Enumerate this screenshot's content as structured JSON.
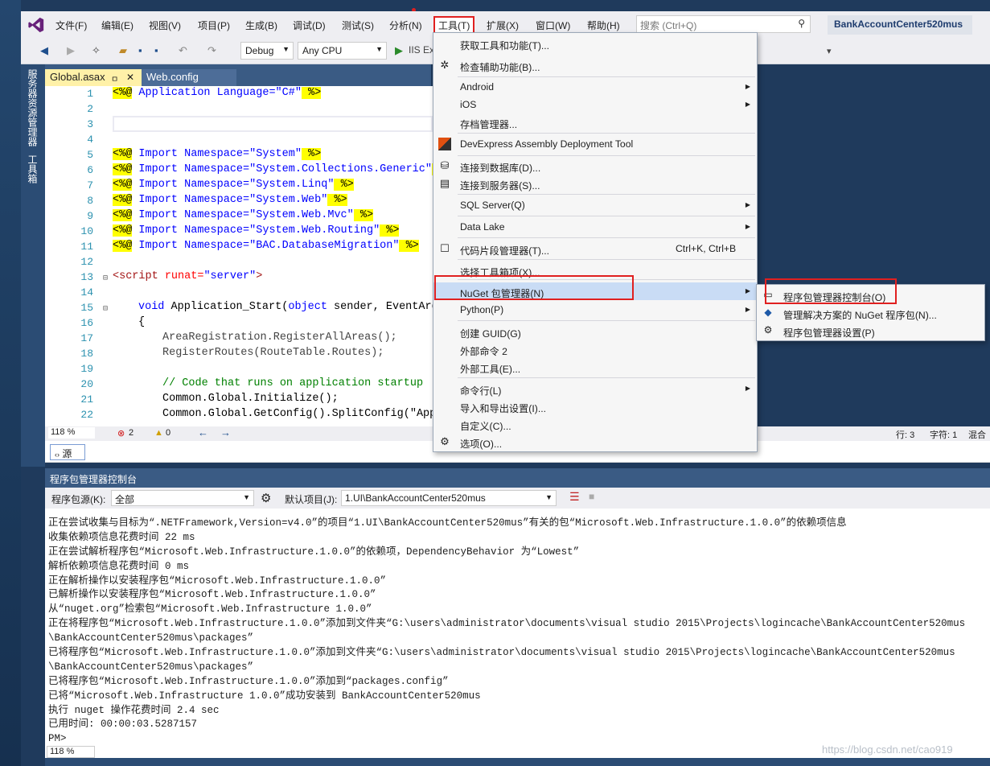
{
  "window": {
    "solution_name": "BankAccountCenter520mus",
    "search_placeholder": "搜索 (Ctrl+Q)"
  },
  "menubar": [
    "文件(F)",
    "编辑(E)",
    "视图(V)",
    "项目(P)",
    "生成(B)",
    "调试(D)",
    "测试(S)",
    "分析(N)",
    "工具(T)",
    "扩展(X)",
    "窗口(W)",
    "帮助(H)"
  ],
  "toolbar": {
    "config": "Debug",
    "platform": "Any CPU",
    "run_label": "IIS Ex"
  },
  "sidebar": {
    "server_explorer": "服务器资源管理器",
    "toolbox": "工具箱"
  },
  "tabs": {
    "active": "Global.asax",
    "pin": "ㅁ",
    "close": "✕",
    "other": "Web.config"
  },
  "editor": {
    "line_numbers": [
      "1",
      "2",
      "3",
      "4",
      "5",
      "6",
      "7",
      "8",
      "9",
      "10",
      "11",
      "12",
      "13",
      "14",
      "15",
      "16",
      "17",
      "18",
      "19",
      "20",
      "21",
      "22"
    ],
    "line1": {
      "d": "<%@",
      "kw": " Application Language=",
      "v": "\"C#\"",
      "e": " %>"
    },
    "imports": [
      {
        "d": "<%@",
        "kw": " Import Namespace=",
        "v": "\"System\"",
        "e": " %>"
      },
      {
        "d": "<%@",
        "kw": " Import Namespace=",
        "v": "\"System.Collections.Generic\"",
        "e": " %>"
      },
      {
        "d": "<%@",
        "kw": " Import Namespace=",
        "v": "\"System.Linq\"",
        "e": " %>"
      },
      {
        "d": "<%@",
        "kw": " Import Namespace=",
        "v": "\"System.Web\"",
        "e": " %>"
      },
      {
        "d": "<%@",
        "kw": " Import Namespace=",
        "v": "\"System.Web.Mvc\"",
        "e": " %>"
      },
      {
        "d": "<%@",
        "kw": " Import Namespace=",
        "v": "\"System.Web.Routing\"",
        "e": " %>"
      },
      {
        "d": "<%@",
        "kw": " Import Namespace=",
        "v": "\"BAC.DatabaseMigration\"",
        "e": " %>"
      }
    ],
    "l13": {
      "tag": "<script",
      "attr": " runat=",
      "val": "\"server\"",
      "end": ">"
    },
    "l15": {
      "kw1": "void",
      "name": " Application_Start(",
      "kw2": "object",
      "rest": " sender, EventArgs"
    },
    "l16": "{",
    "l17": "AreaRegistration.RegisterAllAreas();",
    "l18": "RegisterRoutes(RouteTable.Routes);",
    "l20": "// Code that runs on application startup",
    "l21": "Common.Global.Initialize();",
    "l22": "Common.Global.GetConfig().SplitConfig(\"App_E"
  },
  "statusbar": {
    "zoom": "118 %",
    "errors": "2",
    "warnings": "0",
    "row": "行: 3",
    "col": "字符: 1",
    "mode": "混合"
  },
  "source_button": "源",
  "pmc": {
    "title": "程序包管理器控制台",
    "source_label": "程序包源(K):",
    "source_value": "全部",
    "project_label": "默认项目(J):",
    "project_value": "1.UI\\BankAccountCenter520mus",
    "output": [
      "正在尝试收集与目标为“.NETFramework,Version=v4.0”的项目“1.UI\\BankAccountCenter520mus”有关的包“Microsoft.Web.Infrastructure.1.0.0”的依赖项信息",
      "收集依赖项信息花费时间 22 ms",
      "正在尝试解析程序包“Microsoft.Web.Infrastructure.1.0.0”的依赖项，DependencyBehavior 为“Lowest”",
      "解析依赖项信息花费时间 0 ms",
      "正在解析操作以安装程序包“Microsoft.Web.Infrastructure.1.0.0”",
      "已解析操作以安装程序包“Microsoft.Web.Infrastructure.1.0.0”",
      "从“nuget.org”检索包“Microsoft.Web.Infrastructure 1.0.0”",
      "正在将程序包“Microsoft.Web.Infrastructure.1.0.0”添加到文件夹“G:\\users\\administrator\\documents\\visual studio 2015\\Projects\\logincache\\BankAccountCenter520mus",
      "\\BankAccountCenter520mus\\packages”",
      "已将程序包“Microsoft.Web.Infrastructure.1.0.0”添加到文件夹“G:\\users\\administrator\\documents\\visual studio 2015\\Projects\\logincache\\BankAccountCenter520mus",
      "\\BankAccountCenter520mus\\packages”",
      "已将程序包“Microsoft.Web.Infrastructure.1.0.0”添加到“packages.config”",
      "已将“Microsoft.Web.Infrastructure 1.0.0”成功安装到 BankAccountCenter520mus",
      "执行 nuget 操作花费时间 2.4 sec",
      "已用时间: 00:00:03.5287157",
      "PM>"
    ],
    "zoom": "118 %"
  },
  "tools_menu": [
    {
      "label": "获取工具和功能(T)..."
    },
    {
      "label": "检查辅助功能(B)..."
    },
    {
      "label": "Android"
    },
    {
      "label": "iOS"
    },
    {
      "label": "存档管理器..."
    },
    {
      "label": "DevExpress Assembly Deployment Tool"
    },
    {
      "label": "连接到数据库(D)..."
    },
    {
      "label": "连接到服务器(S)..."
    },
    {
      "label": "SQL Server(Q)"
    },
    {
      "label": "Data Lake"
    },
    {
      "label": "代码片段管理器(T)...",
      "shortcut": "Ctrl+K, Ctrl+B"
    },
    {
      "label": "选择工具箱项(X)..."
    },
    {
      "label": "NuGet 包管理器(N)"
    },
    {
      "label": "Python(P)"
    },
    {
      "label": "创建 GUID(G)"
    },
    {
      "label": "外部命令 2"
    },
    {
      "label": "外部工具(E)..."
    },
    {
      "label": "命令行(L)"
    },
    {
      "label": "导入和导出设置(I)..."
    },
    {
      "label": "自定义(C)..."
    },
    {
      "label": "选项(O)..."
    }
  ],
  "nuget_submenu": [
    {
      "label": "程序包管理器控制台(O)"
    },
    {
      "label": "管理解决方案的 NuGet 程序包(N)..."
    },
    {
      "label": "程序包管理器设置(P)"
    }
  ],
  "watermark": "https://blog.csdn.net/cao919"
}
